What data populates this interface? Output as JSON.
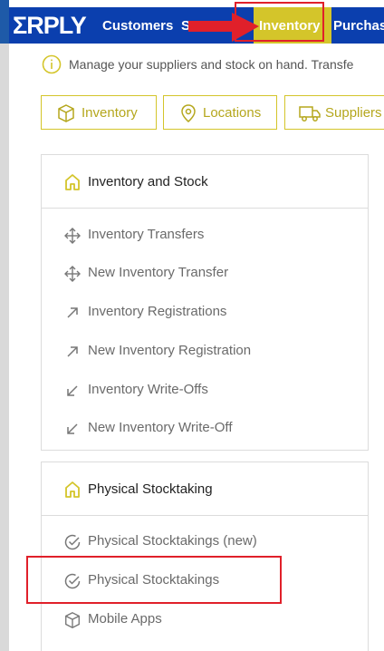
{
  "app": {
    "logo": "ΣRPLY"
  },
  "nav": {
    "customers": "Customers",
    "s_partial": "S",
    "inventory": "Inventory",
    "purchases": "Purchase"
  },
  "info": {
    "text": "Manage your suppliers and stock on hand. Transfe"
  },
  "tabs": [
    {
      "label": "Inventory",
      "icon": "box-icon"
    },
    {
      "label": "Locations",
      "icon": "location-pin-icon"
    },
    {
      "label": "Suppliers",
      "icon": "truck-icon"
    }
  ],
  "inventory_panel": {
    "title": "Inventory and Stock",
    "items": [
      {
        "label": "Inventory Transfers",
        "icon": "move-arrows-icon"
      },
      {
        "label": "New Inventory Transfer",
        "icon": "move-arrows-icon"
      },
      {
        "label": "Inventory Registrations",
        "icon": "arrow-up-right-icon"
      },
      {
        "label": "New Inventory Registration",
        "icon": "arrow-up-right-icon"
      },
      {
        "label": "Inventory Write-Offs",
        "icon": "arrow-down-left-icon"
      },
      {
        "label": "New Inventory Write-Off",
        "icon": "arrow-down-left-icon"
      }
    ]
  },
  "stocktaking_panel": {
    "title": "Physical Stocktaking",
    "items": [
      {
        "label": "Physical Stocktakings (new)",
        "icon": "check-circle-icon"
      },
      {
        "label": "Physical Stocktakings",
        "icon": "check-circle-icon"
      },
      {
        "label": "Mobile Apps",
        "icon": "box-icon"
      }
    ]
  },
  "colors": {
    "nav_bg": "#0b3fae",
    "accent": "#d4c52a",
    "highlight_red": "#e0202a"
  }
}
